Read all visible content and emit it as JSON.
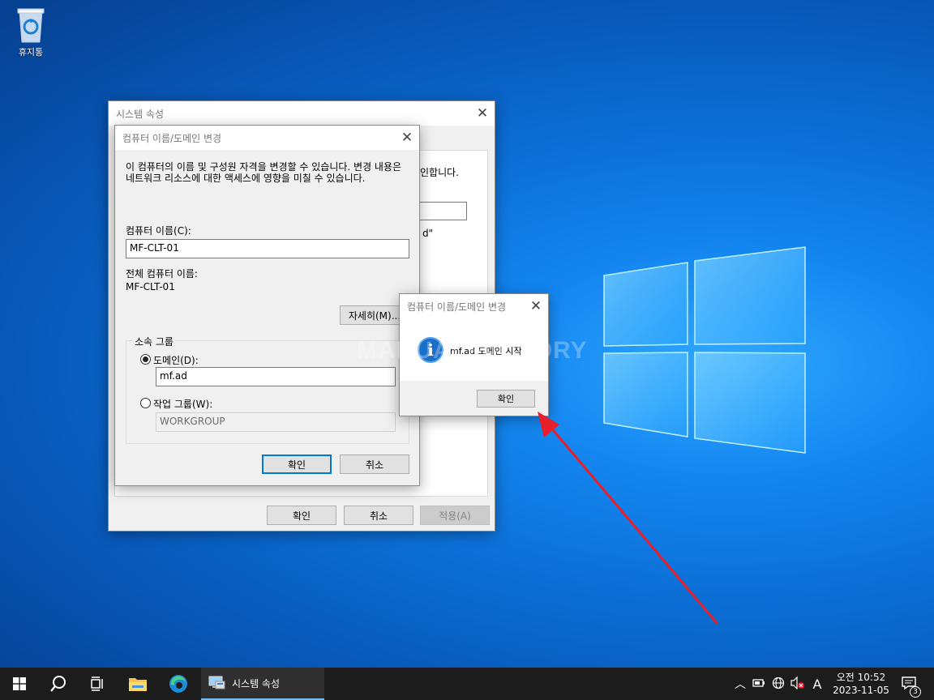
{
  "desktop": {
    "recycle_bin_label": "휴지통",
    "watermark": "MANUALFACTORY"
  },
  "system_properties": {
    "title": "시스템 속성",
    "partial_text_1": "인합니다.",
    "partial_text_2": "d\"",
    "ok_label": "확인",
    "cancel_label": "취소",
    "apply_label": "적용(A)"
  },
  "rename_dialog": {
    "title": "컴퓨터 이름/도메인 변경",
    "description": "이 컴퓨터의 이름 및 구성원 자격을 변경할 수 있습니다. 변경 내용은 네트워크 리소스에 대한 액세스에 영향을 미칠 수 있습니다.",
    "computer_name_label": "컴퓨터 이름(C):",
    "computer_name_value": "MF-CLT-01",
    "full_name_label": "전체 컴퓨터 이름:",
    "full_name_value": "MF-CLT-01",
    "more_label": "자세히(M)...",
    "member_of_label": "소속 그룹",
    "domain_label": "도메인(D):",
    "domain_value": "mf.ad",
    "workgroup_label": "작업 그룹(W):",
    "workgroup_value": "WORKGROUP",
    "ok_label": "확인",
    "cancel_label": "취소"
  },
  "message_box": {
    "title": "컴퓨터 이름/도메인 변경",
    "message": "mf.ad 도메인 시작",
    "ok_label": "확인",
    "icon": "info-icon"
  },
  "taskbar": {
    "app_label": "시스템 속성",
    "ime_label": "A",
    "time": "오전 10:52",
    "date": "2023-11-05",
    "notification_count": "3"
  },
  "colors": {
    "accent": "#0078d7",
    "arrow": "#e8202a",
    "taskbar": "#1c1c1c"
  }
}
